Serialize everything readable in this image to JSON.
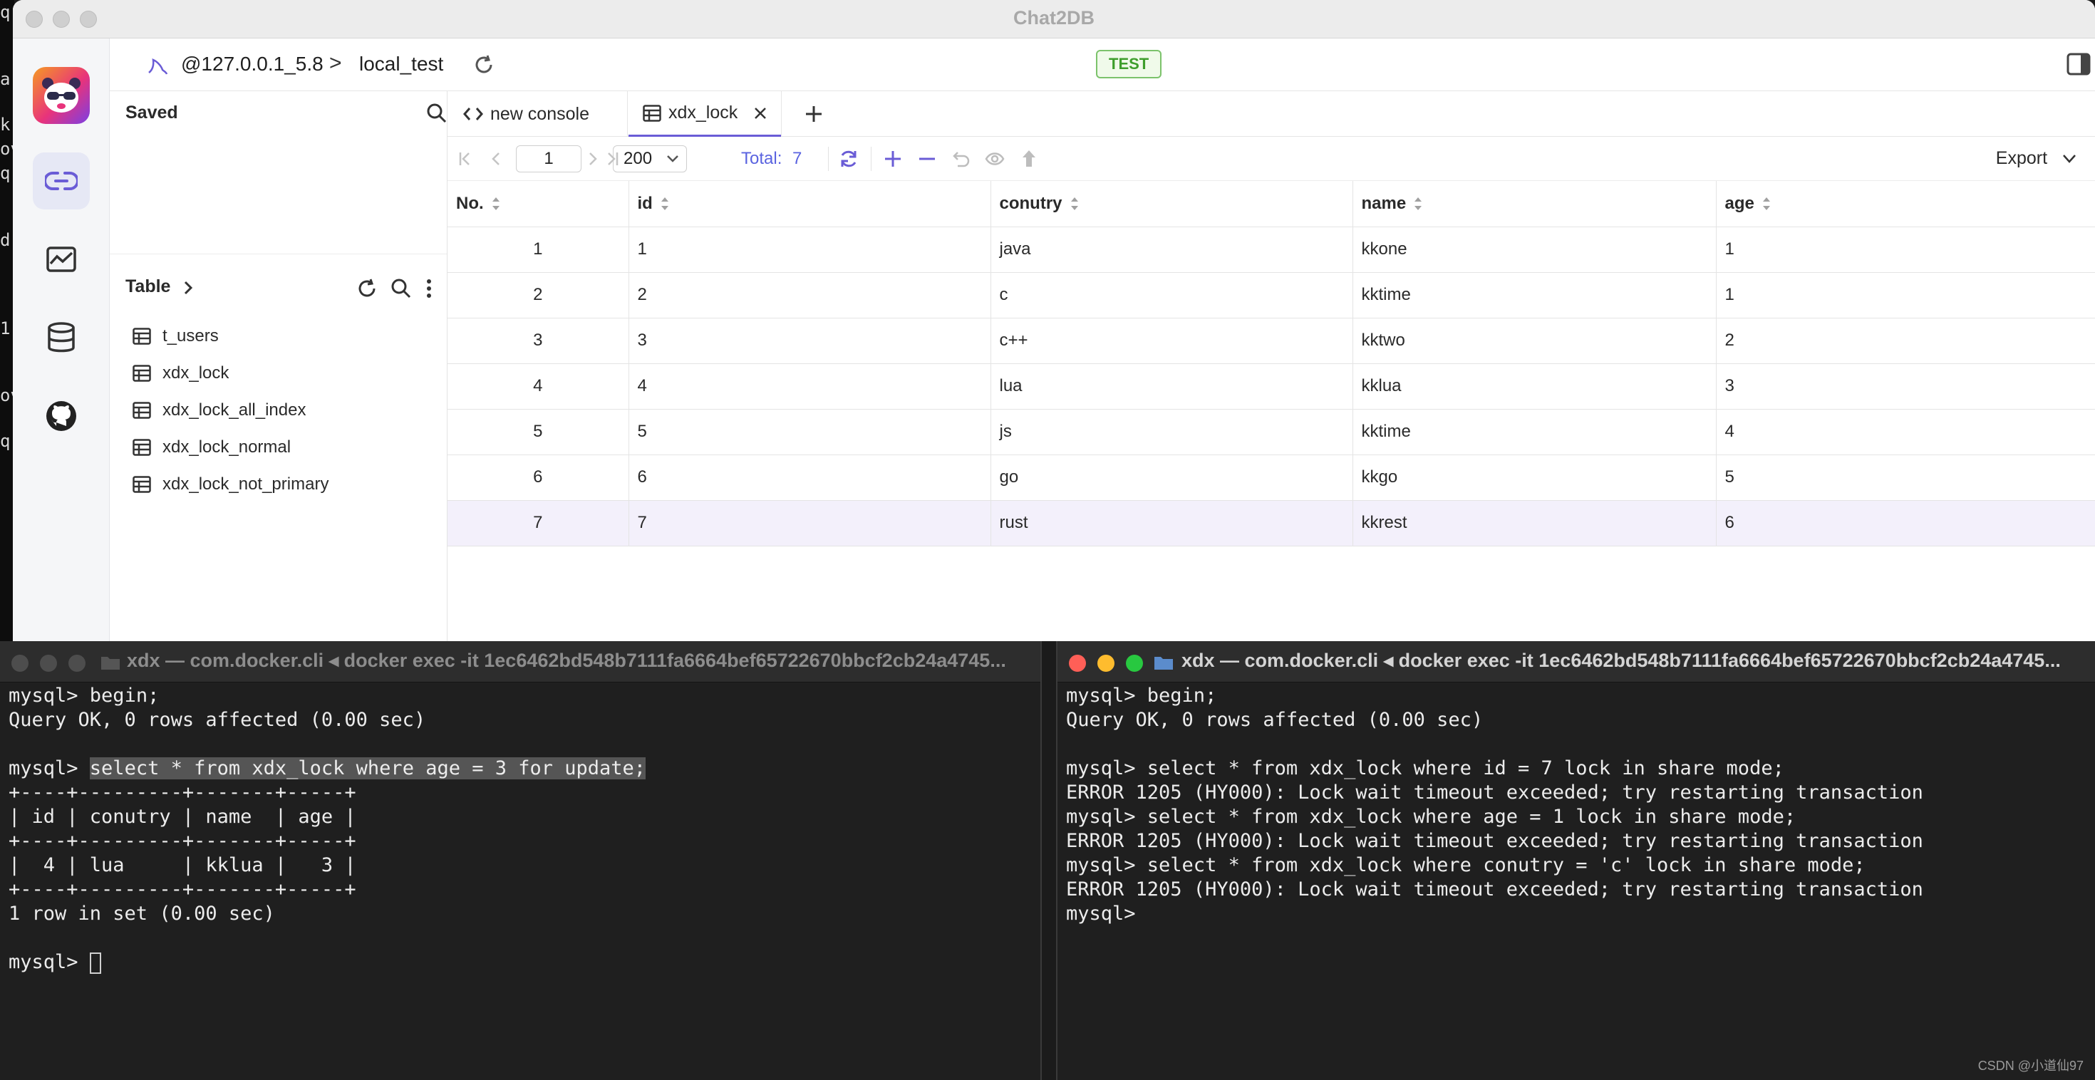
{
  "window": {
    "title": "Chat2DB"
  },
  "connection": {
    "host": "@127.0.0.1_5.8",
    "separator": ">",
    "database": "local_test",
    "env_badge": "TEST"
  },
  "sidebar": {
    "saved_label": "Saved",
    "table_label": "Table",
    "tables": [
      "t_users",
      "xdx_lock",
      "xdx_lock_all_index",
      "xdx_lock_normal",
      "xdx_lock_not_primary"
    ]
  },
  "tabs": [
    {
      "label": "new console",
      "icon": "code-icon"
    },
    {
      "label": "xdx_lock",
      "icon": "table-icon",
      "active": true
    }
  ],
  "toolbar": {
    "page": "1",
    "page_size": "200",
    "total_label": "Total:",
    "total_value": "7",
    "export_label": "Export"
  },
  "grid": {
    "columns": [
      "No.",
      "id",
      "conutry",
      "name",
      "age"
    ],
    "rows": [
      [
        "1",
        "1",
        "java",
        "kkone",
        "1"
      ],
      [
        "2",
        "2",
        "c",
        "kktime",
        "1"
      ],
      [
        "3",
        "3",
        "c++",
        "kktwo",
        "2"
      ],
      [
        "4",
        "4",
        "lua",
        "kklua",
        "3"
      ],
      [
        "5",
        "5",
        "js",
        "kktime",
        "4"
      ],
      [
        "6",
        "6",
        "go",
        "kkgo",
        "5"
      ],
      [
        "7",
        "7",
        "rust",
        "kkrest",
        "6"
      ]
    ],
    "selected_row": 7
  },
  "terminal_left": {
    "title": "xdx — com.docker.cli ◂ docker exec -it 1ec6462bd548b7111fa6664bef65722670bbcf2cb24a4745...",
    "prompt": "mysql> ",
    "cmd1": "begin;",
    "out1": "Query OK, 0 rows affected (0.00 sec)",
    "cmd2": "select * from xdx_lock where age = 3 for update;",
    "table_border": "+----+---------+-------+-----+",
    "table_header": "| id | conutry | name  | age |",
    "table_row": "|  4 | lua     | kklua |   3 |",
    "summary": "1 row in set (0.00 sec)"
  },
  "terminal_right": {
    "title": "xdx — com.docker.cli ◂ docker exec -it 1ec6462bd548b7111fa6664bef65722670bbcf2cb24a4745...",
    "lines": [
      "mysql> begin;",
      "Query OK, 0 rows affected (0.00 sec)",
      "",
      "mysql> select * from xdx_lock where id = 7 lock in share mode;",
      "ERROR 1205 (HY000): Lock wait timeout exceeded; try restarting transaction",
      "mysql> select * from xdx_lock where age = 1 lock in share mode;",
      "ERROR 1205 (HY000): Lock wait timeout exceeded; try restarting transaction",
      "mysql> select * from xdx_lock where conutry = 'c' lock in share mode;",
      "ERROR 1205 (HY000): Lock wait timeout exceeded; try restarting transaction",
      "mysql>"
    ]
  },
  "background_terminal": {
    "fragments": [
      "q:",
      "ar",
      "k-",
      "ov",
      "q:",
      "d",
      "1",
      "ov",
      "q:"
    ]
  },
  "watermark": "CSDN @小道仙97",
  "colors": {
    "accent": "#6a5cd6",
    "badge_green": "#3e9e2c",
    "selected_row": "#f3f0fb",
    "terminal_bg": "#1f1f1f"
  }
}
